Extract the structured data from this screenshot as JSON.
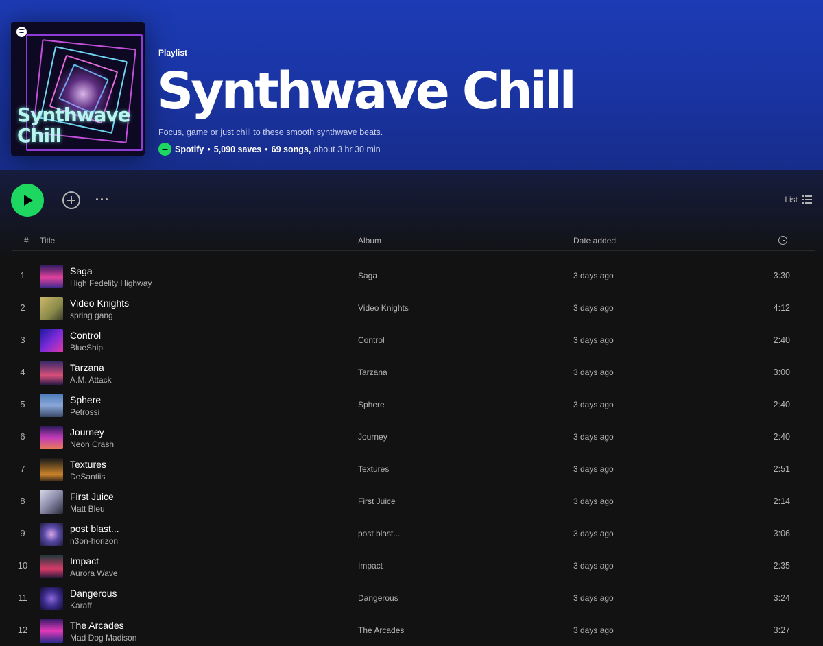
{
  "header": {
    "type_label": "Playlist",
    "title": "Synthwave Chill",
    "cover_title_line1": "Synthwave",
    "cover_title_line2": "Chill",
    "description": "Focus, game or just chill to these smooth synthwave beats.",
    "owner": "Spotify",
    "saves": "5,090 saves",
    "songs": "69 songs,",
    "duration": "about 3 hr 30 min"
  },
  "controls": {
    "view_label": "List"
  },
  "columns": {
    "number": "#",
    "title": "Title",
    "album": "Album",
    "date_added": "Date added"
  },
  "colors": {
    "accent": "#1ed760",
    "header_bg": "#1c3bb4",
    "background": "#121212"
  },
  "tracks": [
    {
      "num": "1",
      "title": "Saga",
      "artist": "High Fedelity Highway",
      "album": "Saga",
      "date": "3 days ago",
      "duration": "3:30"
    },
    {
      "num": "2",
      "title": "Video Knights",
      "artist": "spring gang",
      "album": "Video Knights",
      "date": "3 days ago",
      "duration": "4:12"
    },
    {
      "num": "3",
      "title": "Control",
      "artist": "BlueShip",
      "album": "Control",
      "date": "3 days ago",
      "duration": "2:40"
    },
    {
      "num": "4",
      "title": "Tarzana",
      "artist": "A.M. Attack",
      "album": "Tarzana",
      "date": "3 days ago",
      "duration": "3:00"
    },
    {
      "num": "5",
      "title": "Sphere",
      "artist": "Petrossi",
      "album": "Sphere",
      "date": "3 days ago",
      "duration": "2:40"
    },
    {
      "num": "6",
      "title": "Journey",
      "artist": "Neon Crash",
      "album": "Journey",
      "date": "3 days ago",
      "duration": "2:40"
    },
    {
      "num": "7",
      "title": "Textures",
      "artist": "DeSantiis",
      "album": "Textures",
      "date": "3 days ago",
      "duration": "2:51"
    },
    {
      "num": "8",
      "title": "First Juice",
      "artist": "Matt Bleu",
      "album": "First Juice",
      "date": "3 days ago",
      "duration": "2:14"
    },
    {
      "num": "9",
      "title": "post blast...",
      "artist": "n3on-horizon",
      "album": "post blast...",
      "date": "3 days ago",
      "duration": "3:06"
    },
    {
      "num": "10",
      "title": "Impact",
      "artist": "Aurora Wave",
      "album": "Impact",
      "date": "3 days ago",
      "duration": "2:35"
    },
    {
      "num": "11",
      "title": "Dangerous",
      "artist": "Karaff",
      "album": "Dangerous",
      "date": "3 days ago",
      "duration": "3:24"
    },
    {
      "num": "12",
      "title": "The Arcades",
      "artist": "Mad Dog Madison",
      "album": "The Arcades",
      "date": "3 days ago",
      "duration": "3:27"
    }
  ]
}
